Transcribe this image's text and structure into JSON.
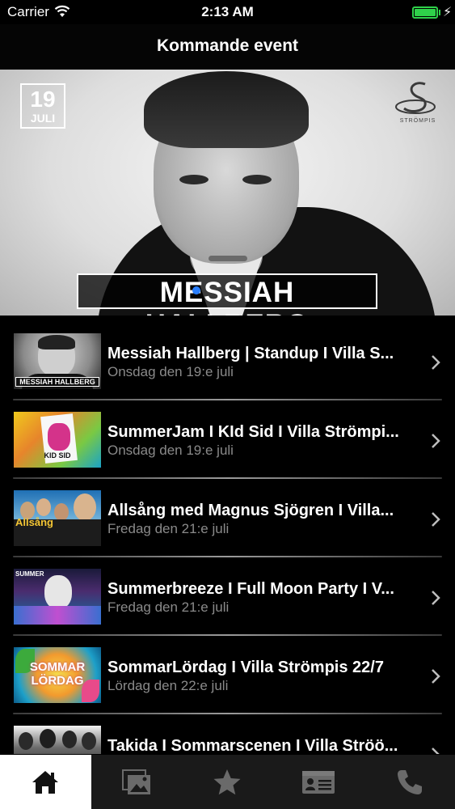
{
  "status_bar": {
    "carrier": "Carrier",
    "time": "2:13 AM",
    "battery_level": 1.0,
    "battery_color": "#2fd14a"
  },
  "nav": {
    "title": "Kommande event"
  },
  "hero": {
    "date_day": "19",
    "date_month": "JULI",
    "name": "MESSIAH HALLBERG",
    "venue_name": "STRÖMPIS",
    "page_indicator_color": "#2a7fff"
  },
  "events": [
    {
      "title": "Messiah Hallberg | Standup I Villa S...",
      "date": "Onsdag den 19:e juli",
      "thumb_label": "MESSIAH HALLBERG"
    },
    {
      "title": "SummerJam I KId Sid I Villa Strömpi...",
      "date": "Onsdag den 19:e juli",
      "thumb_label": "KID SID"
    },
    {
      "title": "Allsång med Magnus Sjögren I Villa...",
      "date": "Fredag den 21:e juli",
      "thumb_label": "Allsång"
    },
    {
      "title": "Summerbreeze I Full Moon Party I V...",
      "date": "Fredag den 21:e juli",
      "thumb_label": "SUMMER"
    },
    {
      "title": "SommarLördag I Villa Strömpis 22/7",
      "date": "Lördag den 22:e juli",
      "thumb_label": "SOMMAR LÖRDAG"
    },
    {
      "title": "Takida I Sommarscenen I Villa Ströö...",
      "date": "",
      "thumb_label": ""
    }
  ],
  "tab_bar": {
    "tabs": [
      {
        "icon": "home-icon",
        "active": true
      },
      {
        "icon": "gallery-icon",
        "active": false
      },
      {
        "icon": "star-icon",
        "active": false
      },
      {
        "icon": "contact-card-icon",
        "active": false
      },
      {
        "icon": "phone-icon",
        "active": false
      }
    ]
  }
}
